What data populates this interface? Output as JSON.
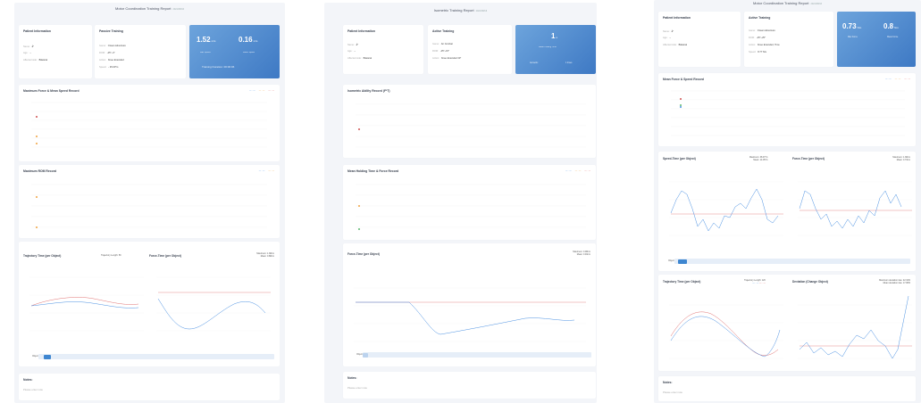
{
  "colors": {
    "blue": "#4a90e2",
    "orange": "#f0a340",
    "red": "#e06060",
    "green": "#5bb870",
    "accent": "#3e79c4"
  },
  "report1": {
    "title": "Motor Coordination Training Report",
    "patient": {
      "title": "Patient Information",
      "name_label": "Name:",
      "name": "å°",
      "age_label": "Age:",
      "age": "--",
      "side_label": "Affected side:",
      "side": "Bilateral"
    },
    "training": {
      "title": "Passive Training",
      "game_label": "Game:",
      "game": "Ocean Adventure",
      "range_label": "ROM:",
      "range": "-45°~4°",
      "action_label": "Action:",
      "action": "Knee Extended",
      "speed_label": "Speed:",
      "speed": "- 45.00°/s"
    },
    "hero": {
      "v1": "1.52",
      "u1": "m/s",
      "l1": "Max Speed",
      "v2": "0.16",
      "u2": "m/s",
      "l2": "Mean Speed",
      "duration": "Training Duration: 00:00:06"
    },
    "c1_title": "Maximum Force & Mean Speed Record",
    "c2_title": "Maximum ROM Record",
    "c3_title": "Trajectory Time (per Object)",
    "c3_stat": "Trajectory Length: 59",
    "c4_title": "Force-Time (per Object)",
    "c4_stat1": "Maximum: 1.38nm",
    "c4_stat2": "Mean: 0.88nm",
    "object_label": "Object",
    "notes_title": "Notes:",
    "notes_placeholder": "Please enter note"
  },
  "report2": {
    "title": "Isometric Training Report",
    "patient": {
      "title": "Patient Information",
      "name_label": "Name:",
      "name": "å°",
      "age_label": "Age:",
      "age": "--",
      "side_label": "Affected side:",
      "side": "Bilateral"
    },
    "training": {
      "title": "Active Training",
      "game_label": "Game:",
      "game": "Air Combat",
      "range_label": "ROM:",
      "range": "-45°~15°",
      "action_label": "Action:",
      "action": "Knee Extended 30°"
    },
    "hero": {
      "v1": "1",
      "u1": "s",
      "l1": "Mean Holding Time",
      "l2": "Isometric",
      "l3": "1 times"
    },
    "c1_title": "Isometric Ability Record (F*T)",
    "c2_title": "Mean Holding Time & Force Record",
    "c3_title": "Force-Time (per Object)",
    "c3_stat1": "Maximum: 0.98nm",
    "c3_stat2": "Mean: 0.46nm",
    "object_label": "Object",
    "notes_title": "Notes:",
    "notes_placeholder": "Please enter note"
  },
  "report3": {
    "title": "Motor Coordination Training Report",
    "patient": {
      "title": "Patient Information",
      "name_label": "Name:",
      "name": "å°",
      "age_label": "Age:",
      "age": "--",
      "side_label": "Affected side:",
      "side": "Bilateral"
    },
    "training": {
      "title": "Active Training",
      "game_label": "Game:",
      "game": "Ocean Adventure",
      "range_label": "ROM:",
      "range": "-45°~25°",
      "action_label": "Action:",
      "action": "Knee Extended, Time",
      "speed_label": "Speed:",
      "speed": "8.77 N/s"
    },
    "hero": {
      "v1": "0.73",
      "u1": "Nm",
      "l1": "Max Force",
      "v2": "0.8",
      "u2": "Nm",
      "l2": "Mean Force"
    },
    "c1_title": "Mean Force & Speed Record",
    "c2_title": "Speed-Time (per Object)",
    "c2_stat1": "Maximum: 38.97°/s",
    "c2_stat2": "Mean: 14.05°/s",
    "c3_title": "Force-Time (per Object)",
    "c3_stat1": "Maximum: 1.38nm",
    "c3_stat2": "Mean: 0.73nm",
    "c4_title": "Trajectory Time (per Object)",
    "c4_stat": "Trajectory Length: 120",
    "c5_title": "Deviation (Change Object)",
    "c5_stat1": "Maximum deviation rate: 22.34%",
    "c5_stat2": "Mean deviation rate: 17.08%",
    "object_label": "Object",
    "notes_title": "Notes:",
    "notes_placeholder": "Please enter note"
  }
}
